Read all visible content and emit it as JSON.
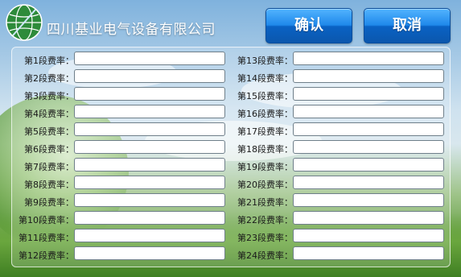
{
  "header": {
    "company_name": "四川基业电气设备有限公司",
    "confirm_label": "确认",
    "cancel_label": "取消"
  },
  "colors": {
    "button_top": "#52b4ff",
    "button_bottom": "#0b57ad",
    "logo_green": "#2e8b3a",
    "input_border": "#6f7f8a"
  },
  "rates": {
    "left": [
      {
        "label": "第1段费率：",
        "value": ""
      },
      {
        "label": "第2段费率：",
        "value": ""
      },
      {
        "label": "第3段费率：",
        "value": ""
      },
      {
        "label": "第4段费率：",
        "value": ""
      },
      {
        "label": "第5段费率：",
        "value": ""
      },
      {
        "label": "第6段费率：",
        "value": ""
      },
      {
        "label": "第7段费率：",
        "value": ""
      },
      {
        "label": "第8段费率：",
        "value": ""
      },
      {
        "label": "第9段费率：",
        "value": ""
      },
      {
        "label": "第10段费率：",
        "value": ""
      },
      {
        "label": "第11段费率：",
        "value": ""
      },
      {
        "label": "第12段费率：",
        "value": ""
      }
    ],
    "right": [
      {
        "label": "第13段费率：",
        "value": ""
      },
      {
        "label": "第14段费率：",
        "value": ""
      },
      {
        "label": "第15段费率：",
        "value": ""
      },
      {
        "label": "第16段费率：",
        "value": ""
      },
      {
        "label": "第17段费率：",
        "value": ""
      },
      {
        "label": "第18段费率：",
        "value": ""
      },
      {
        "label": "第19段费率：",
        "value": ""
      },
      {
        "label": "第20段费率：",
        "value": ""
      },
      {
        "label": "第21段费率：",
        "value": ""
      },
      {
        "label": "第22段费率：",
        "value": ""
      },
      {
        "label": "第23段费率：",
        "value": ""
      },
      {
        "label": "第24段费率：",
        "value": ""
      }
    ]
  }
}
